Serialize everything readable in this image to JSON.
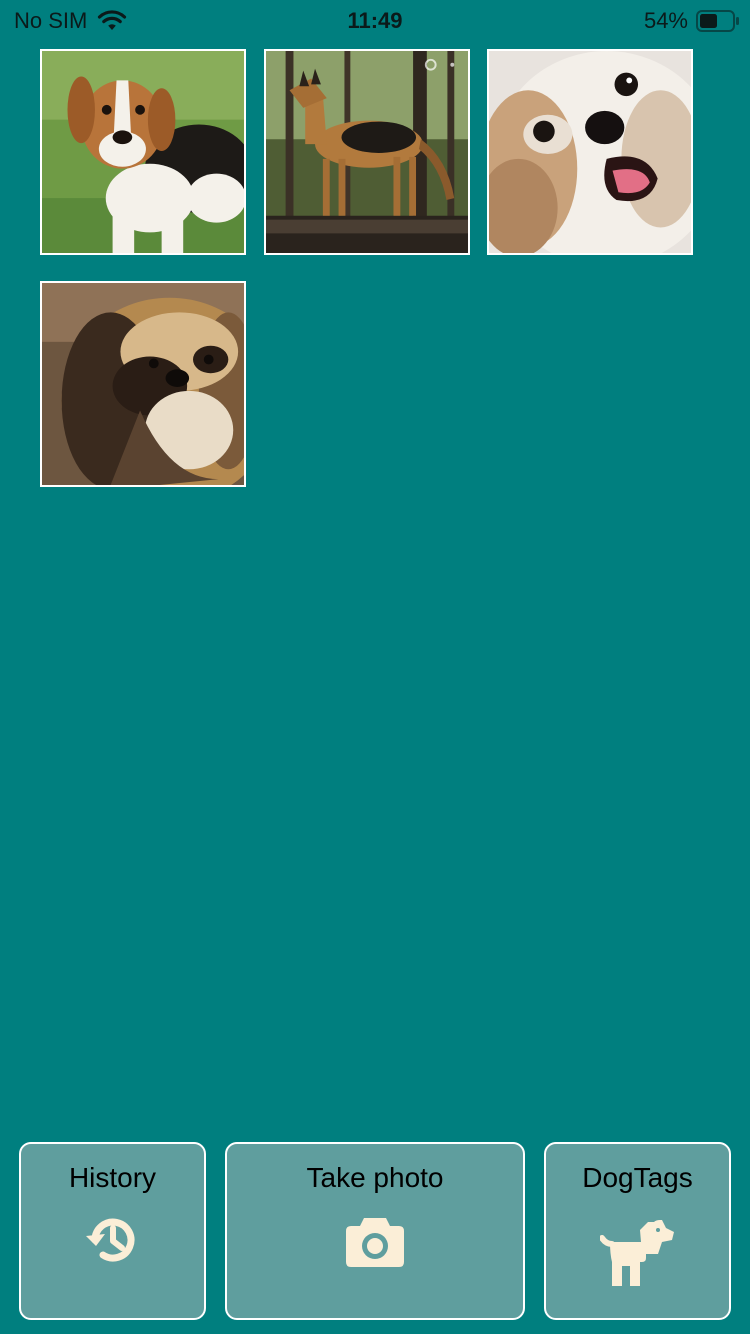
{
  "status_bar": {
    "carrier": "No SIM",
    "time": "11:49",
    "battery": "54%",
    "battery_level": 0.54,
    "icons": [
      "wifi-icon",
      "battery-icon"
    ]
  },
  "gallery": {
    "photos": [
      {
        "name": "beagle-photo"
      },
      {
        "name": "german-shepherd-photo"
      },
      {
        "name": "shih-tzu-photo"
      },
      {
        "name": "long-haired-dog-photo"
      }
    ]
  },
  "bottom_bar": {
    "history": {
      "label": "History",
      "icon": "history-icon"
    },
    "take_photo": {
      "label": "Take photo",
      "icon": "camera-icon"
    },
    "dogtags": {
      "label": "DogTags",
      "icon": "dog-icon"
    }
  },
  "colors": {
    "background": "#007f7f",
    "button_fill": "#5f9e9e",
    "icon_cream": "#fbeed7",
    "border": "#ffffff"
  }
}
